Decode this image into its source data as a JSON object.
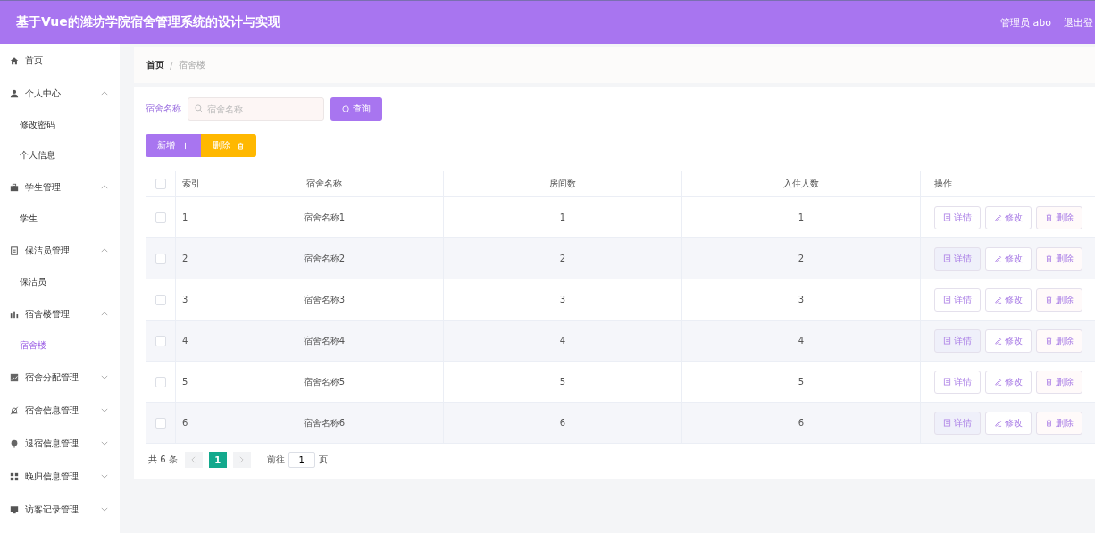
{
  "header": {
    "title": "基于Vue的潍坊学院宿舍管理系统的设计与实现",
    "user": "管理员 abo",
    "logout": "退出登"
  },
  "sidebar": {
    "items": [
      {
        "label": "首页"
      },
      {
        "label": "个人中心",
        "expanded": true,
        "children": [
          {
            "label": "修改密码",
            "selected": false
          },
          {
            "label": "个人信息",
            "selected": false
          }
        ]
      },
      {
        "label": "学生管理",
        "expanded": true,
        "children": [
          {
            "label": "学生",
            "selected": false
          }
        ]
      },
      {
        "label": "保洁员管理",
        "expanded": true,
        "children": [
          {
            "label": "保洁员",
            "selected": false
          }
        ]
      },
      {
        "label": "宿舍楼管理",
        "expanded": true,
        "children": [
          {
            "label": "宿舍楼",
            "selected": true
          }
        ]
      },
      {
        "label": "宿舍分配管理",
        "expanded": false
      },
      {
        "label": "宿舍信息管理",
        "expanded": false
      },
      {
        "label": "退宿信息管理",
        "expanded": false
      },
      {
        "label": "晚归信息管理",
        "expanded": false
      },
      {
        "label": "访客记录管理",
        "expanded": false
      }
    ]
  },
  "breadcrumb": {
    "items": [
      "首页",
      "宿舍楼"
    ],
    "separator": "/"
  },
  "search": {
    "label": "宿舍名称",
    "placeholder": "宿舍名称",
    "button": "查询"
  },
  "toolbar": {
    "add": "新增",
    "delete": "删除"
  },
  "table": {
    "select_all_checked": false,
    "columns": [
      "索引",
      "宿舍名称",
      "房间数",
      "入住人数",
      "操作"
    ],
    "rows": [
      {
        "index": "1",
        "name": "宿舍名称1",
        "rooms": "1",
        "residents": "1",
        "checked": false,
        "actions": [
          "详情",
          "修改",
          "删除"
        ]
      },
      {
        "index": "2",
        "name": "宿舍名称2",
        "rooms": "2",
        "residents": "2",
        "checked": false,
        "actions": [
          "详情",
          "修改",
          "删除"
        ]
      },
      {
        "index": "3",
        "name": "宿舍名称3",
        "rooms": "3",
        "residents": "3",
        "checked": false,
        "actions": [
          "详情",
          "修改",
          "删除"
        ]
      },
      {
        "index": "4",
        "name": "宿舍名称4",
        "rooms": "4",
        "residents": "4",
        "checked": false,
        "actions": [
          "详情",
          "修改",
          "删除"
        ]
      },
      {
        "index": "5",
        "name": "宿舍名称5",
        "rooms": "5",
        "residents": "5",
        "checked": false,
        "actions": [
          "详情",
          "修改",
          "删除"
        ]
      },
      {
        "index": "6",
        "name": "宿舍名称6",
        "rooms": "6",
        "residents": "6",
        "checked": false,
        "actions": [
          "详情",
          "修改",
          "删除"
        ]
      }
    ]
  },
  "pagination": {
    "total": "共 6 条",
    "pages": [
      {
        "label": "1",
        "selected": true
      }
    ],
    "goto": "前往",
    "page_input": "1",
    "page_suffix": "页"
  }
}
